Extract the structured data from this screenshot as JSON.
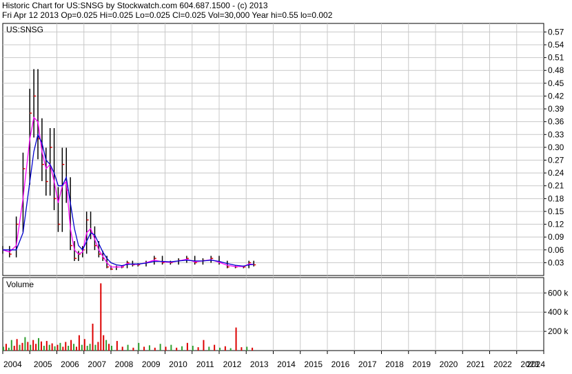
{
  "header": {
    "line1": "Historic Chart for US:SNSG by Stockwatch.com 604.687.1500 - (c) 2013",
    "line2": "Fri Apr 12 2013   Op=0.025  Hi=0.025  Lo=0.025  Cl=0.025  Vol=30,000  Year hi=0.55  lo=0.002"
  },
  "colors": {
    "grid": "#c8c8c8",
    "price_bar": "#000000",
    "ma_short": "#ff00ff",
    "ma_long": "#0000cc",
    "vol_up": "#2e9e2e",
    "vol_down": "#dd0000",
    "close_tick": "#dd0000"
  },
  "chart_data": [
    {
      "type": "line",
      "title": "US:SNSG",
      "y_tick_labels": [
        "0.57",
        "0.54",
        "0.51",
        "0.48",
        "0.45",
        "0.42",
        "0.39",
        "0.36",
        "0.33",
        "0.30",
        "0.27",
        "0.24",
        "0.21",
        "0.18",
        "0.15",
        "0.12",
        "0.09",
        "0.06",
        "0.03"
      ],
      "ylim": [
        0,
        0.59
      ],
      "y_axis": "right",
      "grid": true,
      "x": [
        2004.0,
        2004.25,
        2004.5,
        2004.75,
        2005.0,
        2005.15,
        2005.3,
        2005.45,
        2005.6,
        2005.75,
        2005.9,
        2006.05,
        2006.2,
        2006.35,
        2006.5,
        2006.65,
        2006.8,
        2006.95,
        2007.1,
        2007.25,
        2007.4,
        2007.55,
        2007.7,
        2007.85,
        2008.0,
        2008.2,
        2008.4,
        2008.6,
        2008.8,
        2009.0,
        2009.3,
        2009.6,
        2009.9,
        2010.2,
        2010.5,
        2010.8,
        2011.1,
        2011.4,
        2011.7,
        2012.0,
        2012.3,
        2012.6,
        2012.9,
        2013.1,
        2013.28
      ],
      "series": [
        {
          "values": [
            0.06,
            0.05,
            0.12,
            0.25,
            0.38,
            0.42,
            0.32,
            0.26,
            0.22,
            0.3,
            0.18,
            0.12,
            0.26,
            0.2,
            0.07,
            0.04,
            0.05,
            0.06,
            0.13,
            0.1,
            0.07,
            0.05,
            0.04,
            0.02,
            0.015,
            0.02,
            0.02,
            0.03,
            0.025,
            0.025,
            0.03,
            0.04,
            0.03,
            0.03,
            0.035,
            0.04,
            0.03,
            0.035,
            0.04,
            0.03,
            0.02,
            0.02,
            0.02,
            0.03,
            0.025
          ]
        },
        {
          "values": [
            0.06,
            0.055,
            0.07,
            0.18,
            0.32,
            0.37,
            0.36,
            0.29,
            0.25,
            0.26,
            0.22,
            0.17,
            0.21,
            0.22,
            0.11,
            0.06,
            0.05,
            0.055,
            0.1,
            0.11,
            0.085,
            0.06,
            0.045,
            0.03,
            0.02,
            0.02,
            0.02,
            0.028,
            0.026,
            0.026,
            0.03,
            0.036,
            0.032,
            0.031,
            0.034,
            0.038,
            0.032,
            0.034,
            0.037,
            0.031,
            0.024,
            0.021,
            0.021,
            0.027,
            0.026
          ]
        },
        {
          "values": [
            0.06,
            0.06,
            0.06,
            0.1,
            0.22,
            0.29,
            0.33,
            0.31,
            0.27,
            0.26,
            0.24,
            0.21,
            0.21,
            0.23,
            0.17,
            0.11,
            0.07,
            0.06,
            0.08,
            0.1,
            0.095,
            0.075,
            0.055,
            0.04,
            0.03,
            0.025,
            0.023,
            0.026,
            0.027,
            0.027,
            0.029,
            0.033,
            0.033,
            0.032,
            0.034,
            0.036,
            0.034,
            0.034,
            0.036,
            0.033,
            0.028,
            0.024,
            0.022,
            0.025,
            0.026
          ]
        }
      ]
    },
    {
      "type": "bar",
      "title": "Volume",
      "y_tick_labels": [
        "600 k",
        "400 k",
        "200 k"
      ],
      "ylim": [
        0,
        760
      ],
      "y_axis": "right",
      "grid": true,
      "categories": [
        2004.0,
        2004.1,
        2004.2,
        2004.3,
        2004.4,
        2004.5,
        2004.6,
        2004.7,
        2004.8,
        2004.9,
        2005.0,
        2005.1,
        2005.2,
        2005.3,
        2005.4,
        2005.5,
        2005.6,
        2005.7,
        2005.8,
        2005.9,
        2006.0,
        2006.1,
        2006.2,
        2006.3,
        2006.4,
        2006.5,
        2006.6,
        2006.7,
        2006.8,
        2006.9,
        2007.0,
        2007.1,
        2007.2,
        2007.3,
        2007.4,
        2007.5,
        2007.6,
        2007.7,
        2007.8,
        2007.9,
        2008.0,
        2008.2,
        2008.4,
        2008.6,
        2008.8,
        2009.0,
        2009.2,
        2009.4,
        2009.6,
        2009.8,
        2010.0,
        2010.2,
        2010.4,
        2010.6,
        2010.8,
        2011.0,
        2011.2,
        2011.4,
        2011.6,
        2011.8,
        2012.0,
        2012.2,
        2012.4,
        2012.6,
        2012.8,
        2013.0,
        2013.2
      ],
      "values": [
        40,
        70,
        30,
        110,
        50,
        120,
        60,
        80,
        140,
        90,
        60,
        110,
        70,
        130,
        95,
        50,
        100,
        60,
        75,
        45,
        60,
        80,
        40,
        90,
        50,
        110,
        70,
        40,
        160,
        60,
        120,
        50,
        70,
        280,
        60,
        90,
        700,
        160,
        110,
        70,
        50,
        100,
        40,
        60,
        30,
        80,
        40,
        55,
        30,
        70,
        40,
        60,
        30,
        45,
        80,
        50,
        35,
        110,
        40,
        60,
        30,
        45,
        25,
        240,
        35,
        40,
        30
      ],
      "up": [
        true,
        false,
        true,
        true,
        false,
        false,
        true,
        false,
        true,
        false,
        true,
        false,
        false,
        true,
        false,
        true,
        false,
        true,
        false,
        true,
        false,
        true,
        false,
        false,
        true,
        false,
        true,
        false,
        false,
        true,
        false,
        true,
        true,
        false,
        true,
        false,
        false,
        false,
        true,
        false,
        true,
        false,
        false,
        true,
        false,
        true,
        false,
        true,
        false,
        true,
        false,
        true,
        false,
        true,
        false,
        true,
        false,
        false,
        true,
        false,
        true,
        false,
        true,
        false,
        false,
        true,
        false
      ]
    }
  ],
  "x_tick_labels": [
    "2004",
    "2005",
    "2006",
    "2007",
    "2008",
    "2009",
    "2010",
    "2011",
    "2012",
    "2013",
    "2014",
    "2015",
    "2016",
    "2017",
    "2018",
    "2019",
    "2020",
    "2021",
    "2022",
    "2023",
    "2024"
  ]
}
